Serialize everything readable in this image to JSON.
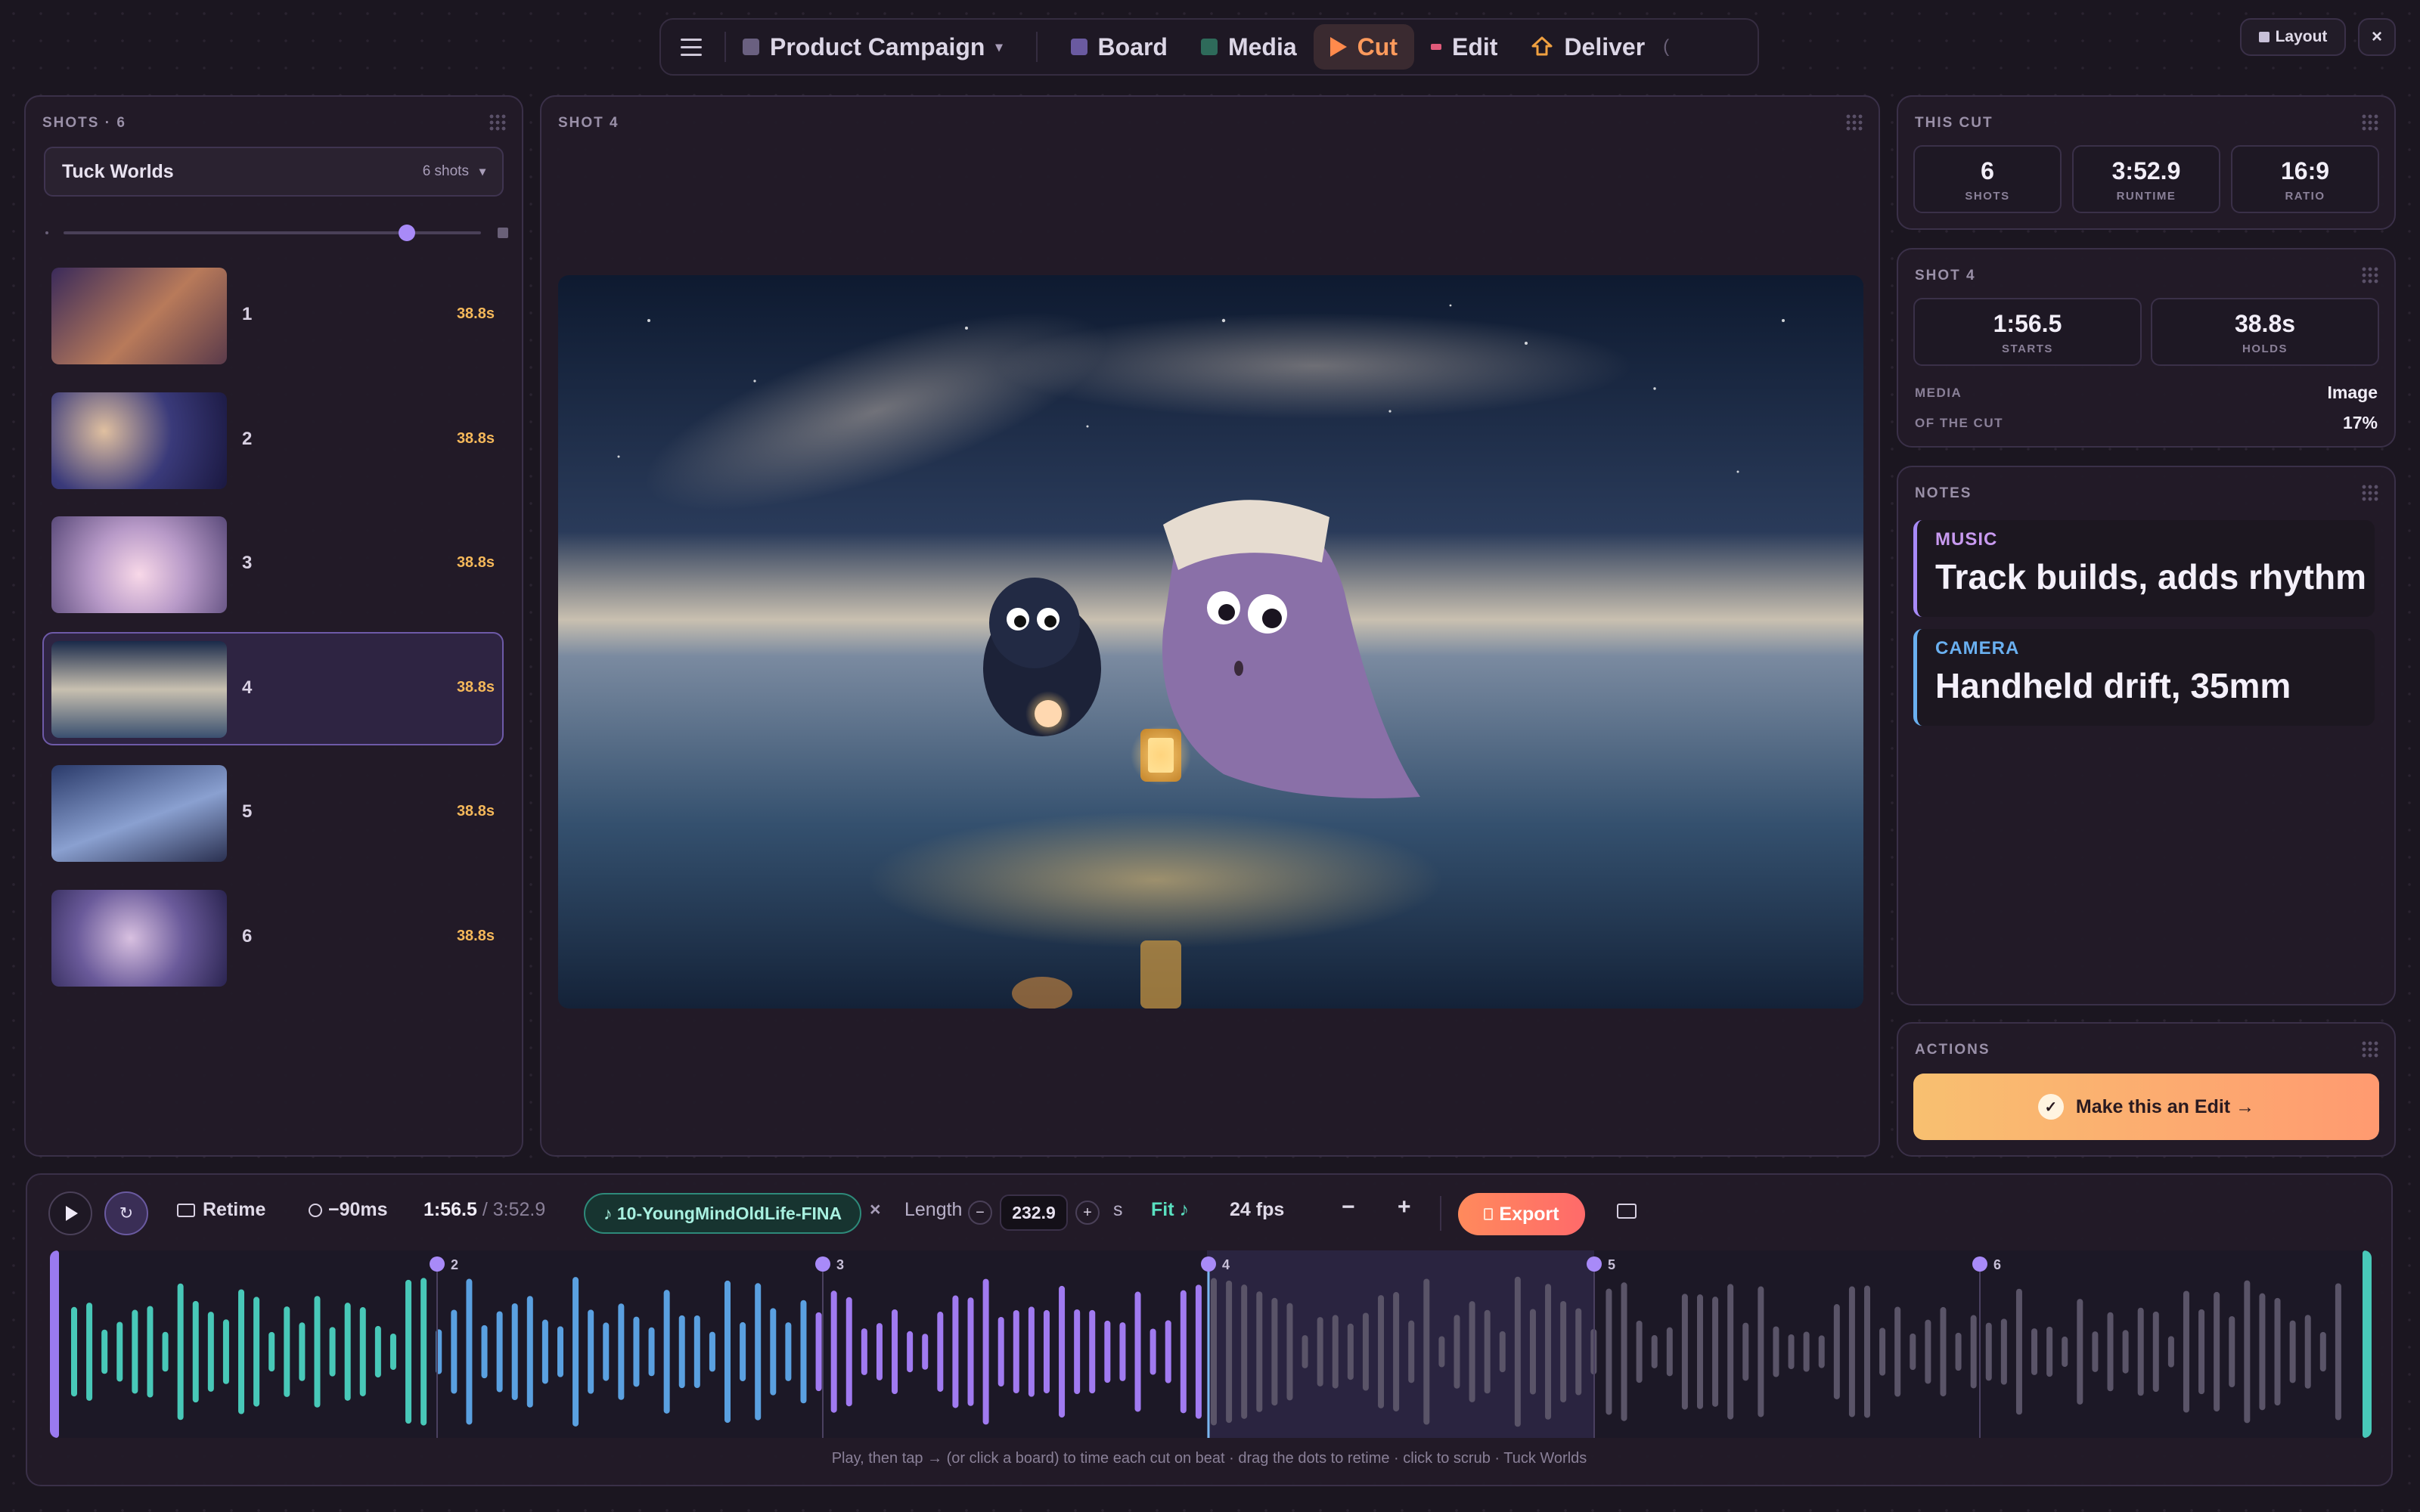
{
  "nav": {
    "project": "Product Campaign",
    "items": [
      {
        "label": "Board",
        "color": "#6a5aa0"
      },
      {
        "label": "Media",
        "color": "#2e6a5a"
      },
      {
        "label": "Cut",
        "color": "#ff8a4c"
      },
      {
        "label": "Edit",
        "color": "#e05a7a"
      },
      {
        "label": "Deliver",
        "color": "#f0a040"
      }
    ],
    "more": "("
  },
  "layout_label": "Layout",
  "close_label": "×",
  "shots": {
    "title": "SHOTS · 6",
    "sequence": "Tuck Worlds",
    "sequence_count": "6 shots",
    "list": [
      {
        "num": "1",
        "dur": "38.8s"
      },
      {
        "num": "2",
        "dur": "38.8s"
      },
      {
        "num": "3",
        "dur": "38.8s"
      },
      {
        "num": "4",
        "dur": "38.8s"
      },
      {
        "num": "5",
        "dur": "38.8s"
      },
      {
        "num": "6",
        "dur": "38.8s"
      }
    ],
    "zoom_level": 0.84
  },
  "viewer": {
    "title": "SHOT 4"
  },
  "this_cut": {
    "title": "THIS CUT",
    "shots": "6",
    "shots_label": "SHOTS",
    "runtime": "3:52.9",
    "runtime_label": "RUNTIME",
    "ratio": "16:9",
    "ratio_label": "RATIO"
  },
  "shot_info": {
    "title": "SHOT 4",
    "starts": "1:56.5",
    "starts_label": "STARTS",
    "holds": "38.8s",
    "holds_label": "HOLDS",
    "media_label": "MEDIA",
    "media": "Image",
    "of_cut_label": "OF THE CUT",
    "of_cut": "17%"
  },
  "notes": {
    "title": "NOTES",
    "items": [
      {
        "label": "MUSIC",
        "text": "Track builds, adds rhythm",
        "color": "#c89af0"
      },
      {
        "label": "CAMERA",
        "text": "Handheld drift, 35mm",
        "color": "#6ab0f0"
      }
    ]
  },
  "actions": {
    "title": "ACTIONS",
    "primary": "Make this an Edit →",
    "check": "✓"
  },
  "transport": {
    "retime": "Retime",
    "offset": "−90ms",
    "time": "1:56.5",
    "total": "/ 3:52.9",
    "track": "♪ 10-YoungMindOldLife-FINA",
    "remove": "×",
    "length_label": "Length",
    "length": "232.9",
    "unit": "s",
    "fit": "Fit ♪",
    "fps": "24 fps",
    "minus": "−",
    "plus": "+",
    "export": "Export",
    "markers": [
      "2",
      "3",
      "4",
      "5",
      "6"
    ],
    "hint": "Play, then tap → (or click a board) to time each cut on beat · drag the dots to retime · click to scrub · Tuck Worlds"
  }
}
